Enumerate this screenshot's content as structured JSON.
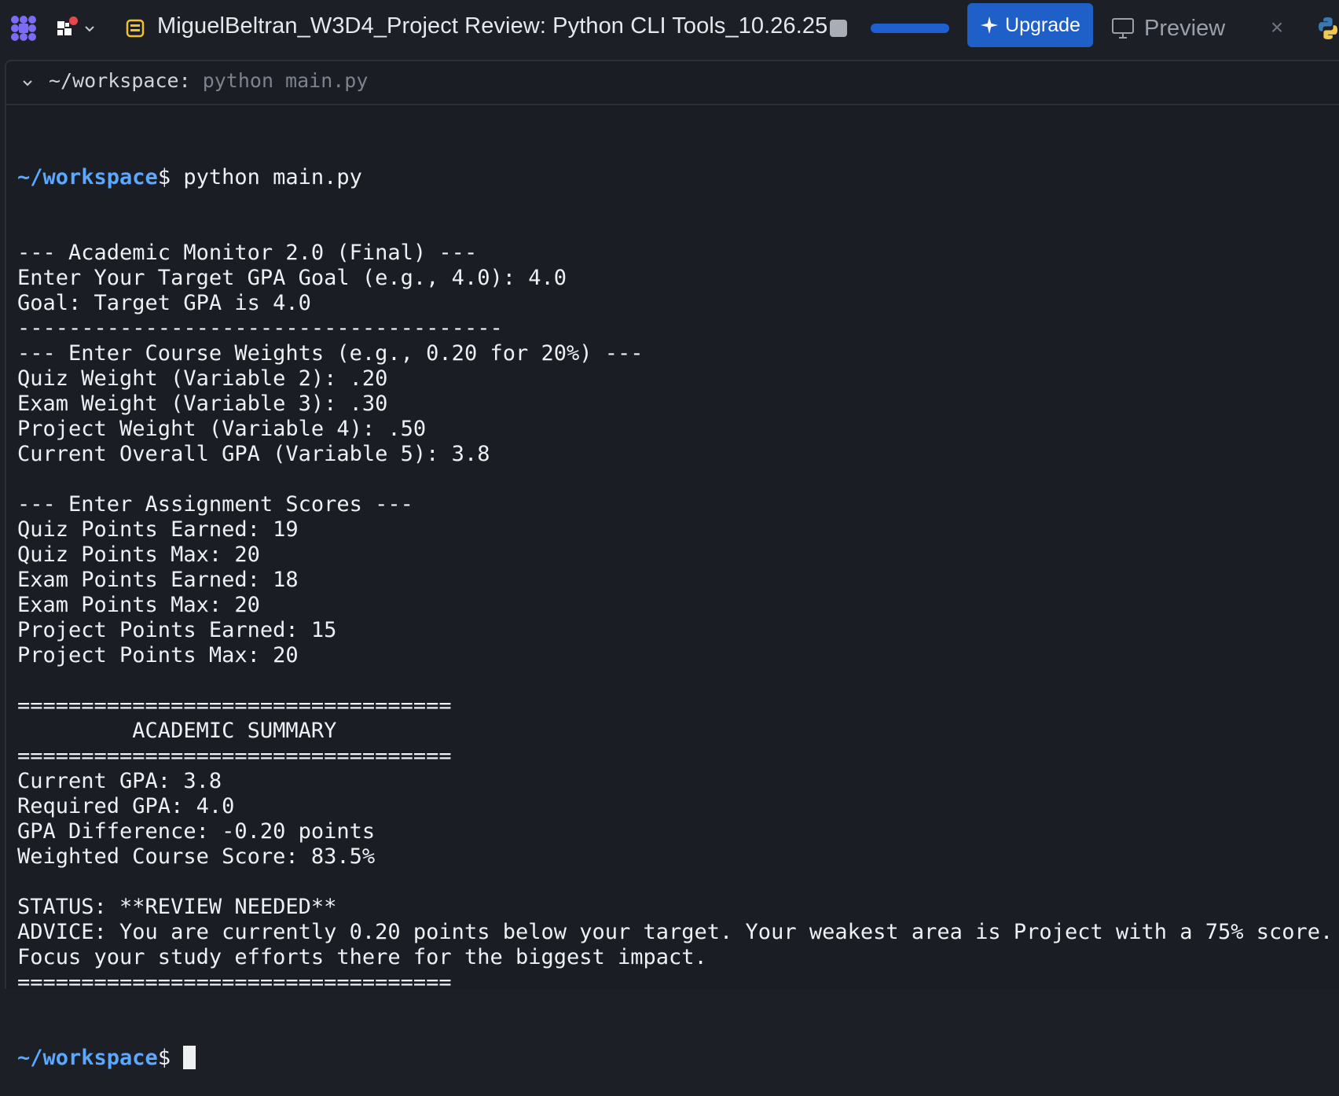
{
  "topbar": {
    "title": "MiguelBeltran_W3D4_Project Review: Python CLI Tools_10.26.25",
    "upgrade_label": "Upgrade",
    "preview_label": "Preview",
    "close_glyph": "×"
  },
  "panel": {
    "path": "~/workspace:",
    "command": "python main.py"
  },
  "terminal": {
    "prompt_path": "~/workspace",
    "prompt_symbol": "$",
    "first_command": " python main.py",
    "lines": [
      "--- Academic Monitor 2.0 (Final) ---",
      "Enter Your Target GPA Goal (e.g., 4.0): 4.0",
      "Goal: Target GPA is 4.0",
      "--------------------------------------",
      "--- Enter Course Weights (e.g., 0.20 for 20%) ---",
      "Quiz Weight (Variable 2): .20",
      "Exam Weight (Variable 3): .30",
      "Project Weight (Variable 4): .50",
      "Current Overall GPA (Variable 5): 3.8",
      "",
      "--- Enter Assignment Scores ---",
      "Quiz Points Earned: 19",
      "Quiz Points Max: 20",
      "Exam Points Earned: 18",
      "Exam Points Max: 20",
      "Project Points Earned: 15",
      "Project Points Max: 20",
      "",
      "==================================",
      "         ACADEMIC SUMMARY",
      "==================================",
      "Current GPA: 3.8",
      "Required GPA: 4.0",
      "GPA Difference: -0.20 points",
      "Weighted Course Score: 83.5%",
      "",
      "STATUS: **REVIEW NEEDED**",
      "ADVICE: You are currently 0.20 points below your target. Your weakest area is Project with a 75% score.",
      "Focus your study efforts there for the biggest impact.",
      "=================================="
    ]
  },
  "colors": {
    "background": "#1c1f26",
    "prompt": "#5aa8ff",
    "accent": "#1f5fc8",
    "notification": "#e5484d"
  },
  "icons": {
    "app_logo": "replit-logo-icon",
    "workspace": "workspace-grid-icon",
    "repl": "repl-icon",
    "stop": "stop-icon",
    "upgrade": "sparkle-icon",
    "preview": "monitor-icon",
    "close": "close-icon",
    "python": "python-icon"
  },
  "run_progress": 1.0
}
